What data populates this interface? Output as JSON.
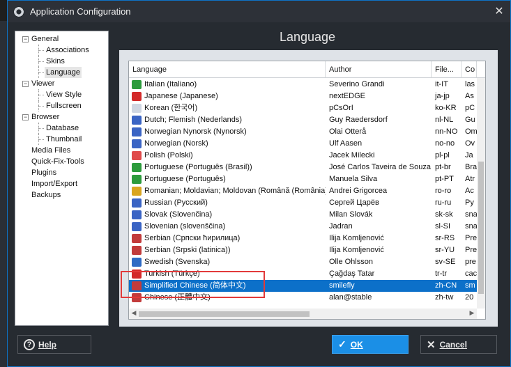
{
  "window": {
    "title": "Application Configuration"
  },
  "tree": [
    {
      "label": "General",
      "level": 0,
      "exp": "−"
    },
    {
      "label": "Associations",
      "level": 1
    },
    {
      "label": "Skins",
      "level": 1
    },
    {
      "label": "Language",
      "level": 1,
      "selected": true
    },
    {
      "label": "Viewer",
      "level": 0,
      "exp": "−"
    },
    {
      "label": "View Style",
      "level": 1
    },
    {
      "label": "Fullscreen",
      "level": 1
    },
    {
      "label": "Browser",
      "level": 0,
      "exp": "−"
    },
    {
      "label": "Database",
      "level": 1
    },
    {
      "label": "Thumbnail",
      "level": 1
    },
    {
      "label": "Media Files",
      "level": 0
    },
    {
      "label": "Quick-Fix-Tools",
      "level": 0
    },
    {
      "label": "Plugins",
      "level": 0
    },
    {
      "label": "Import/Export",
      "level": 0
    },
    {
      "label": "Backups",
      "level": 0
    }
  ],
  "main": {
    "title": "Language"
  },
  "grid": {
    "columns": [
      "Language",
      "Author",
      "File...",
      "Co"
    ],
    "rows": [
      {
        "lang": "Italian (Italiano)",
        "author": "Severino Grandi",
        "file": "it-IT",
        "co": "las",
        "flag": "#2c9b3c"
      },
      {
        "lang": "Japanese (Japanese)",
        "author": "nextEDGE",
        "file": "ja-jp",
        "co": "As",
        "flag": "#d32a2a"
      },
      {
        "lang": "Korean (한국어)",
        "author": "pCsOrI",
        "file": "ko-KR",
        "co": "pC",
        "flag": "#cfd6e2"
      },
      {
        "lang": "Dutch; Flemish (Nederlands)",
        "author": "Guy Raedersdorf",
        "file": "nl-NL",
        "co": "Gu",
        "flag": "#3a64c4"
      },
      {
        "lang": "Norwegian Nynorsk (Nynorsk)",
        "author": "Olai Otterå",
        "file": "nn-NO",
        "co": "Om",
        "flag": "#3a64c4"
      },
      {
        "lang": "Norwegian (Norsk)",
        "author": "Ulf Aasen",
        "file": "no-no",
        "co": "Ov",
        "flag": "#3a64c4"
      },
      {
        "lang": "Polish (Polski)",
        "author": "Jacek Milecki",
        "file": "pl-pl",
        "co": "Ja",
        "flag": "#e04a4a"
      },
      {
        "lang": "Portuguese (Português (Brasil))",
        "author": "José Carlos Taveira de Souza",
        "file": "pt-br",
        "co": "Bra",
        "flag": "#2c9b3c"
      },
      {
        "lang": "Portuguese (Português)",
        "author": "Manuela Silva",
        "file": "pt-PT",
        "co": "Atr",
        "flag": "#2c9b3c"
      },
      {
        "lang": "Romanian; Moldavian; Moldovan (Română (România))",
        "author": "Andrei Grigorcea",
        "file": "ro-ro",
        "co": "Ac",
        "flag": "#d9a520"
      },
      {
        "lang": "Russian (Русский)",
        "author": "Сергей Царёв",
        "file": "ru-ru",
        "co": "Ру",
        "flag": "#3a64c4"
      },
      {
        "lang": "Slovak (Slovenčina)",
        "author": "Milan Slovák",
        "file": "sk-sk",
        "co": "sna",
        "flag": "#3a64c4"
      },
      {
        "lang": "Slovenian (slovenščina)",
        "author": "Jadran",
        "file": "sl-SI",
        "co": "sna",
        "flag": "#3a64c4"
      },
      {
        "lang": "Serbian (Српски ћирилица)",
        "author": "Ilija Komljenović",
        "file": "sr-RS",
        "co": "Pre",
        "flag": "#c23b3b"
      },
      {
        "lang": "Serbian (Srpski (latinica))",
        "author": "Ilija Komljenović",
        "file": "sr-YU",
        "co": "Pre",
        "flag": "#c23b3b"
      },
      {
        "lang": "Swedish (Svenska)",
        "author": "Olle Ohlsson",
        "file": "sv-SE",
        "co": "pre",
        "flag": "#2f6bc4"
      },
      {
        "lang": "Turkish (Türkçe)",
        "author": "Çağdaş Tatar",
        "file": "tr-tr",
        "co": "cac",
        "flag": "#d32a2a"
      },
      {
        "lang": "Simplified Chinese (简体中文)",
        "author": "smilefly",
        "file": "zh-CN",
        "co": "sm",
        "flag": "#c23b3b",
        "selected": true
      },
      {
        "lang": "Chinese (正體中文)",
        "author": "alan@stable",
        "file": "zh-tw",
        "co": "20",
        "flag": "#c23b3b"
      }
    ]
  },
  "buttons": {
    "help": "Help",
    "ok": "OK",
    "cancel": "Cancel"
  }
}
